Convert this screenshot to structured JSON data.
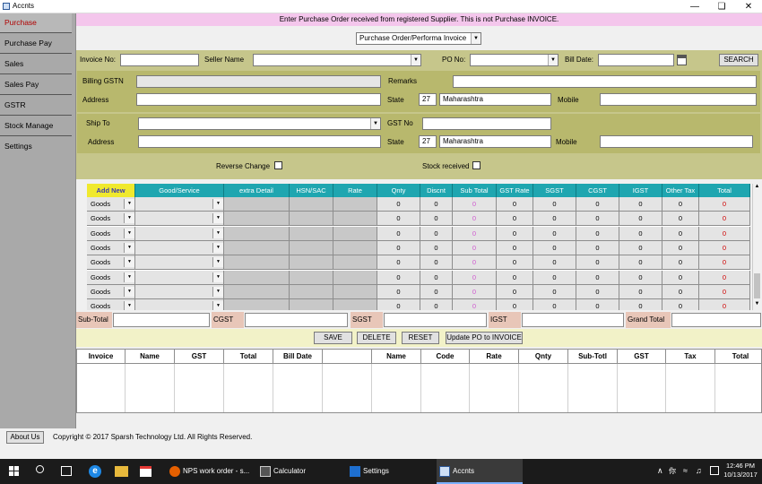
{
  "window": {
    "title": "Accnts"
  },
  "sidebar": {
    "items": [
      {
        "label": "Purchase"
      },
      {
        "label": "Purchase Pay"
      },
      {
        "label": "Sales"
      },
      {
        "label": "Sales Pay"
      },
      {
        "label": "GSTR"
      },
      {
        "label": "Stock Manage"
      },
      {
        "label": "Settings"
      }
    ]
  },
  "banner": "Enter Purchase Order received from registered Supplier. This is not Purchase INVOICE.",
  "doc_type": "Purchase Order/Performa Invoice",
  "form": {
    "invoice_no_label": "Invoice No:",
    "seller_name_label": "Seller Name",
    "po_no_label": "PO No:",
    "bill_date_label": "Bill Date:",
    "search_label": "SEARCH",
    "billing_gstn_label": "Billing GSTN",
    "remarks_label": "Remarks",
    "address_label": "Address",
    "state_label": "State",
    "state_code": "27",
    "state_name": "Maharashtra",
    "mobile_label": "Mobile",
    "ship_to_label": "Ship To",
    "gst_no_label": "GST No",
    "ship_address_label": "Address",
    "ship_state_label": "State",
    "ship_state_code": "27",
    "ship_state_name": "Maharashtra",
    "ship_mobile_label": "Mobile",
    "reverse_change_label": "Reverse Change",
    "stock_received_label": "Stock received"
  },
  "grid": {
    "headers": [
      "Add New",
      "Good/Service",
      "extra Detail",
      "HSN/SAC",
      "Rate",
      "Qnty",
      "Discnt",
      "Sub Total",
      "GST Rate",
      "SGST",
      "CGST",
      "IGST",
      "Other Tax",
      "Total"
    ],
    "row_type": "Goods",
    "zero": "0"
  },
  "totals": {
    "subtotal_label": "Sub-Total",
    "cgst_label": "CGST",
    "sgst_label": "SGST",
    "igst_label": "IGST",
    "grand_total_label": "Grand Total"
  },
  "buttons": {
    "save": "SAVE",
    "delete": "DELETE",
    "reset": "RESET",
    "update": "Update PO to INVOICE"
  },
  "lower_table": {
    "headers": [
      "Invoice",
      "Name",
      "GST",
      "Total",
      "Bill Date",
      "",
      "Name",
      "Code",
      "Rate",
      "Qnty",
      "Sub-Totl",
      "GST",
      "Tax",
      "Total"
    ]
  },
  "footer": {
    "about": "About Us",
    "copyright": "Copyright © 2017 Sparsh Technology Ltd. All Rights Reserved."
  },
  "taskbar": {
    "apps": [
      {
        "label": "NPS work order - s..."
      },
      {
        "label": "Calculator"
      },
      {
        "label": "Settings"
      },
      {
        "label": "Accnts"
      }
    ],
    "time": "12:46 PM",
    "date": "10/13/2017"
  }
}
